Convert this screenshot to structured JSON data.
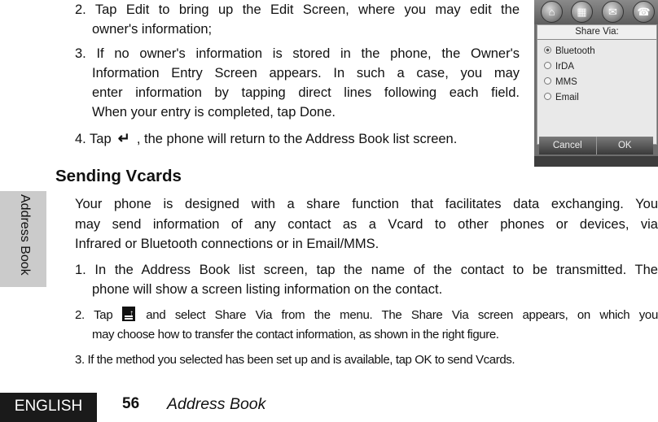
{
  "top_steps": [
    {
      "lines": [
        "2. Tap Edit to bring up the Edit Screen, where you may edit the",
        "owner's information;"
      ]
    },
    {
      "lines": [
        "3. If no owner's information is stored in the phone, the Owner's",
        "Information Entry Screen appears. In such a case, you may",
        "enter information by tapping direct lines following each field.",
        "When your entry is completed, tap Done."
      ]
    },
    {
      "before_icon": "4. Tap",
      "icon": "back-arrow",
      "icon_glyph": "↵",
      "after_icon": ", the phone will return to the Address Book list screen."
    }
  ],
  "section_title": "Sending Vcards",
  "intro_lines": [
    "Your phone is designed with a share function that facilitates data exchanging. You",
    "may send information of any contact as a Vcard to other phones or devices, via",
    "Infrared or Bluetooth connections or in Email/MMS."
  ],
  "step1_lines": [
    "1. In the Address Book list screen, tap the name of the contact to be transmitted. The",
    "phone will show a screen listing information on the contact."
  ],
  "step2": {
    "before_icon": "2. Tap",
    "icon": "menu-icon",
    "after_icon": "and select Share Via from the menu. The Share Via screen appears, on which you",
    "line2": "may choose how to transfer the contact information, as shown in the right figure."
  },
  "step3": "3. If the method you selected has been set up and is available, tap OK to send Vcards.",
  "side_tab": "Address Book",
  "footer": {
    "language": "ENGLISH",
    "page_number": "56",
    "chapter": "Address Book"
  },
  "phone": {
    "toolbar_icons": [
      "home-icon",
      "contacts-icon",
      "messages-icon",
      "end-call-icon"
    ],
    "toolbar_glyphs": [
      "⌂",
      "▦",
      "✉",
      "☎"
    ],
    "dialog_title": "Share Via:",
    "options": [
      {
        "label": "Bluetooth",
        "selected": true
      },
      {
        "label": "IrDA",
        "selected": false
      },
      {
        "label": "MMS",
        "selected": false
      },
      {
        "label": "Email",
        "selected": false
      }
    ],
    "cancel_label": "Cancel",
    "ok_label": "OK"
  }
}
